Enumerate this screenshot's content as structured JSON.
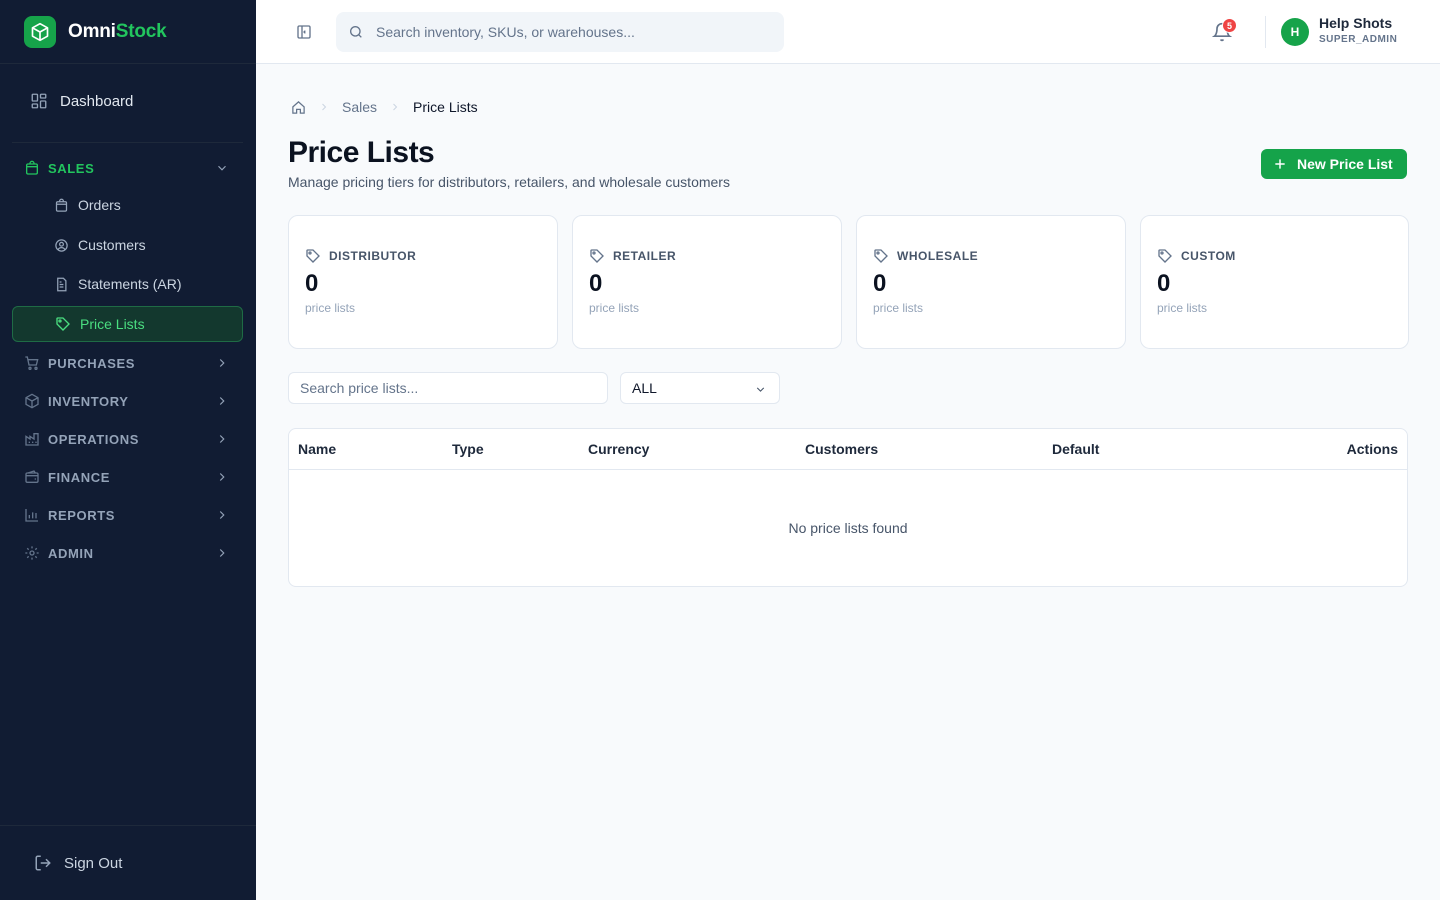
{
  "app": {
    "brand_part1": "Omni",
    "brand_part2": "Stock",
    "accent_color": "#16a34a"
  },
  "sidebar": {
    "dashboard_label": "Dashboard",
    "groups": [
      {
        "label": "SALES",
        "icon": "shopping-bag-icon",
        "expanded": true
      },
      {
        "label": "PURCHASES",
        "icon": "cart-icon",
        "expanded": false
      },
      {
        "label": "INVENTORY",
        "icon": "box-icon",
        "expanded": false
      },
      {
        "label": "OPERATIONS",
        "icon": "factory-icon",
        "expanded": false
      },
      {
        "label": "FINANCE",
        "icon": "wallet-icon",
        "expanded": false
      },
      {
        "label": "REPORTS",
        "icon": "bar-chart-icon",
        "expanded": false
      },
      {
        "label": "ADMIN",
        "icon": "gear-icon",
        "expanded": false
      }
    ],
    "sales_items": [
      {
        "label": "Orders",
        "icon": "shopping-bag-icon"
      },
      {
        "label": "Customers",
        "icon": "user-circle-icon"
      },
      {
        "label": "Statements (AR)",
        "icon": "document-icon"
      },
      {
        "label": "Price Lists",
        "icon": "tag-icon",
        "active": true
      }
    ],
    "signout_label": "Sign Out"
  },
  "topbar": {
    "search_placeholder": "Search inventory, SKUs, or warehouses...",
    "notification_count": "5",
    "user": {
      "initial": "H",
      "name": "Help Shots",
      "role": "SUPER_ADMIN"
    }
  },
  "breadcrumb": {
    "section": "Sales",
    "current": "Price Lists"
  },
  "page": {
    "title": "Price Lists",
    "subtitle": "Manage pricing tiers for distributors, retailers, and wholesale customers",
    "new_button_label": "New Price List"
  },
  "cards": [
    {
      "label": "DISTRIBUTOR",
      "count": "0",
      "unit": "price lists"
    },
    {
      "label": "RETAILER",
      "count": "0",
      "unit": "price lists"
    },
    {
      "label": "WHOLESALE",
      "count": "0",
      "unit": "price lists"
    },
    {
      "label": "CUSTOM",
      "count": "0",
      "unit": "price lists"
    }
  ],
  "filters": {
    "search_placeholder": "Search price lists...",
    "type_selected": "ALL"
  },
  "table": {
    "columns": [
      "Name",
      "Type",
      "Currency",
      "Customers",
      "Default",
      "Actions"
    ],
    "rows": [],
    "empty_message": "No price lists found"
  }
}
